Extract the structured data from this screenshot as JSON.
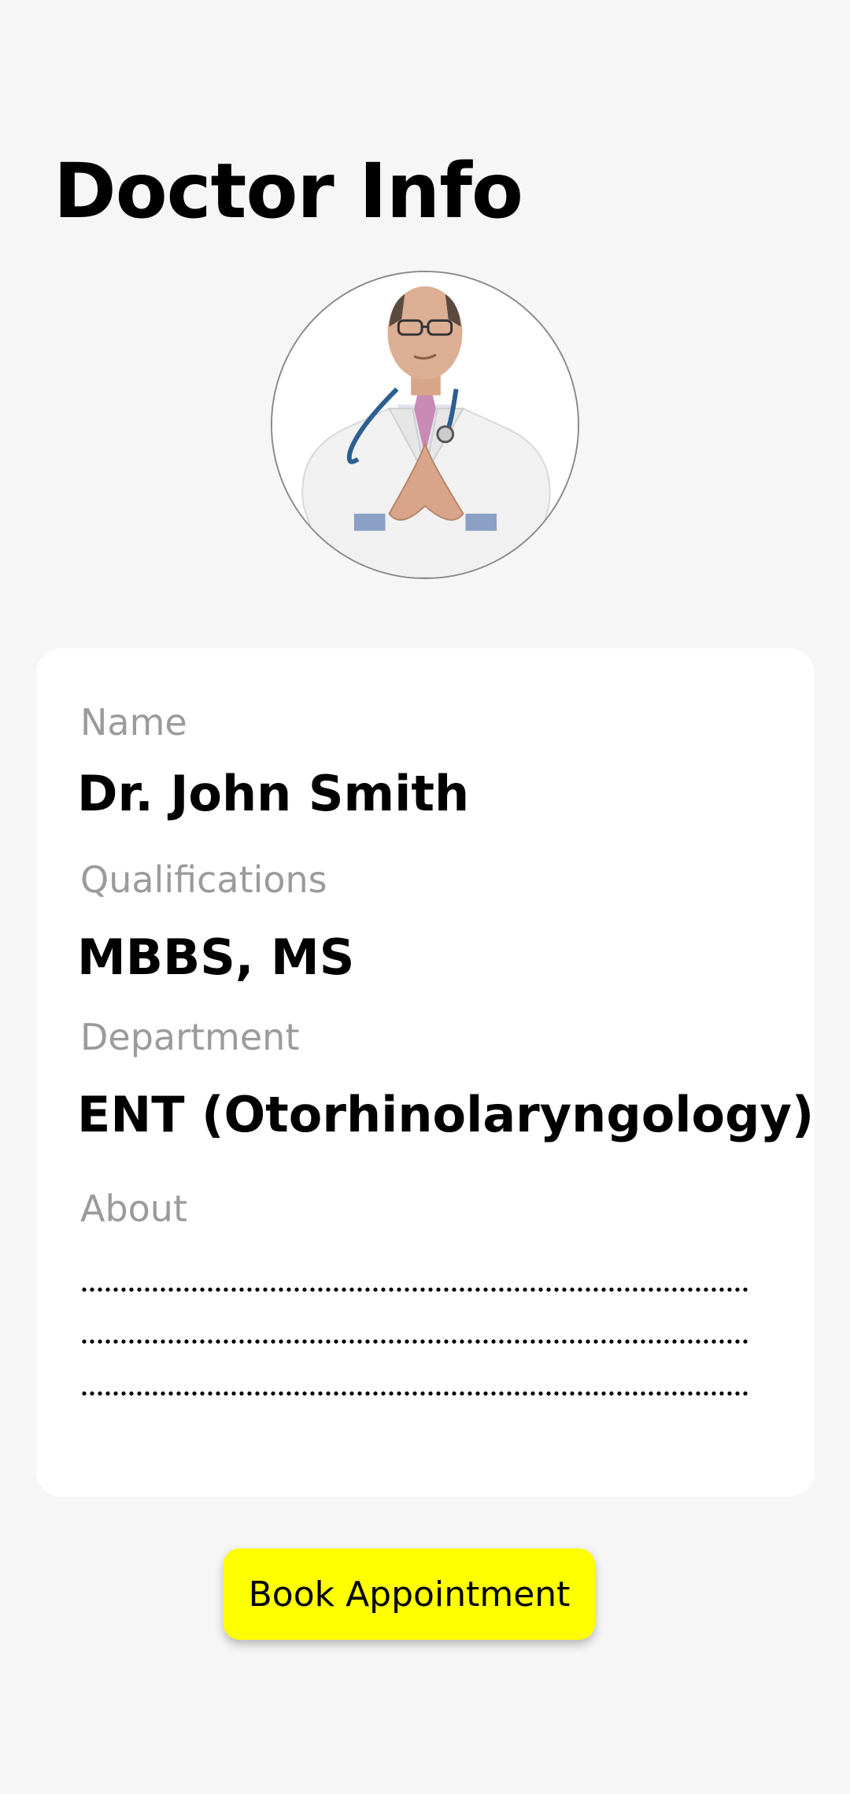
{
  "header": {
    "title": "Doctor Info"
  },
  "profile": {
    "avatar_icon": "doctor-photo"
  },
  "details": {
    "name_label": "Name",
    "name_value": "Dr. John Smith",
    "qualifications_label": "Qualifications",
    "qualifications_value": "MBBS, MS",
    "department_label": "Department",
    "department_value": "ENT (Otorhinolaryngology)",
    "about_label": "About"
  },
  "actions": {
    "book_label": "Book Appointment"
  },
  "colors": {
    "background": "#f6f6f6",
    "card": "#ffffff",
    "label": "#9b9b9b",
    "button": "#ffff00"
  }
}
